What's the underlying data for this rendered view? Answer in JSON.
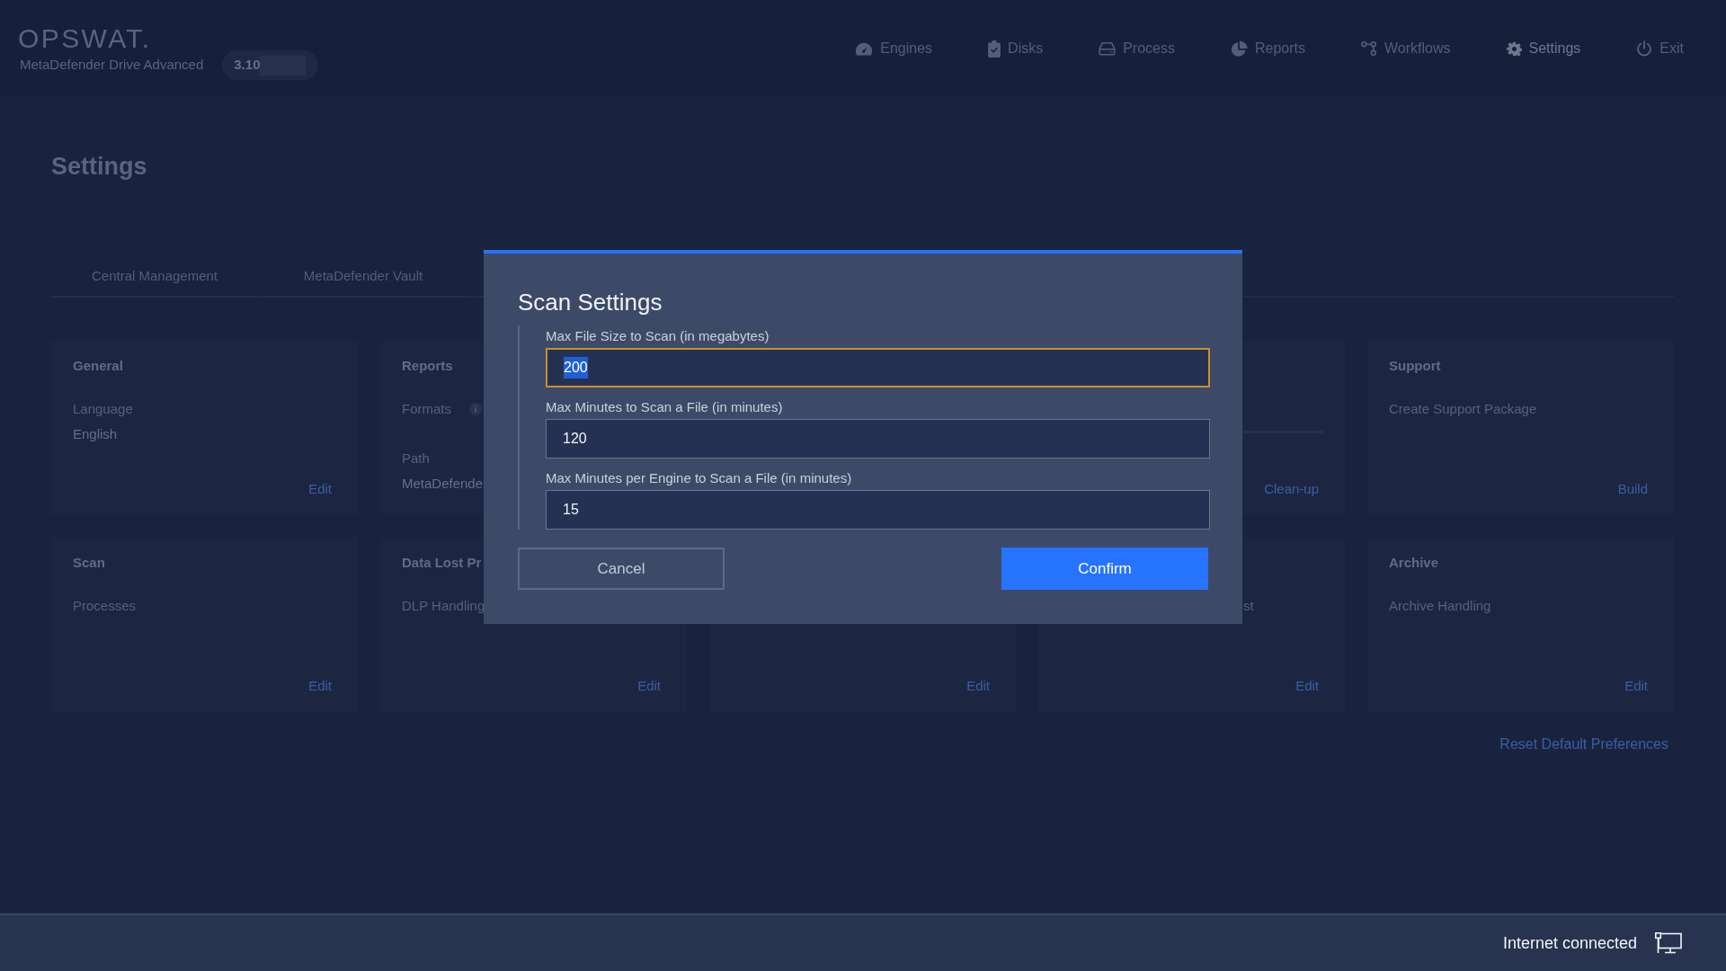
{
  "header": {
    "logo": "OPSWAT.",
    "product": "MetaDefender Drive Advanced",
    "version": "3.10",
    "nav": [
      {
        "label": "Engines",
        "selected": false
      },
      {
        "label": "Disks",
        "selected": false
      },
      {
        "label": "Process",
        "selected": false
      },
      {
        "label": "Reports",
        "selected": false
      },
      {
        "label": "Workflows",
        "selected": false
      },
      {
        "label": "Settings",
        "selected": true
      },
      {
        "label": "Exit",
        "selected": false
      }
    ]
  },
  "page": {
    "title": "Settings",
    "tabs": [
      {
        "label": "Central Management",
        "selected": false
      },
      {
        "label": "MetaDefender Vault",
        "selected": false
      }
    ],
    "cards": [
      {
        "title": "General",
        "fields": [
          {
            "kind": "text",
            "label": "Language",
            "value": "English"
          }
        ],
        "link": "Edit"
      },
      {
        "title": "Reports",
        "fields": [
          {
            "kind": "text",
            "label": "Formats",
            "info": true
          },
          {
            "kind": "text",
            "label": "Path",
            "value": "MetaDefende"
          }
        ]
      },
      {
        "rule": true,
        "link": "Clean-up"
      },
      {
        "title": "Support",
        "fields": [
          {
            "kind": "text",
            "label": "Create Support Package"
          }
        ],
        "link": "Build"
      },
      {
        "title": "Scan",
        "fields": [
          {
            "kind": "text",
            "label": "Processes"
          }
        ],
        "link": "Edit"
      },
      {
        "title": "Data Lost Pr",
        "fields": [
          {
            "kind": "text",
            "label": "DLP Handling"
          }
        ],
        "link": "Edit"
      },
      {
        "link": "Edit"
      },
      {
        "fields": [
          {
            "kind": "clipped",
            "label": "st"
          }
        ],
        "link": "Edit"
      },
      {
        "title": "Archive",
        "fields": [
          {
            "kind": "text",
            "label": "Archive Handling"
          }
        ],
        "link": "Edit"
      }
    ],
    "reset_link": "Reset Default Preferences"
  },
  "dialog": {
    "title": "Scan Settings",
    "fields": [
      {
        "label": "Max File Size to Scan (in megabytes)",
        "value": "200",
        "focused": true
      },
      {
        "label": "Max Minutes to Scan a File (in minutes)",
        "value": "120",
        "focused": false
      },
      {
        "label": "Max Minutes per Engine to Scan a File (in minutes)",
        "value": "15",
        "focused": false
      }
    ],
    "buttons": [
      {
        "label": "Cancel",
        "kind": "secondary"
      },
      {
        "label": "Confirm",
        "kind": "primary"
      }
    ]
  },
  "status_bar": {
    "text": "Internet connected"
  }
}
